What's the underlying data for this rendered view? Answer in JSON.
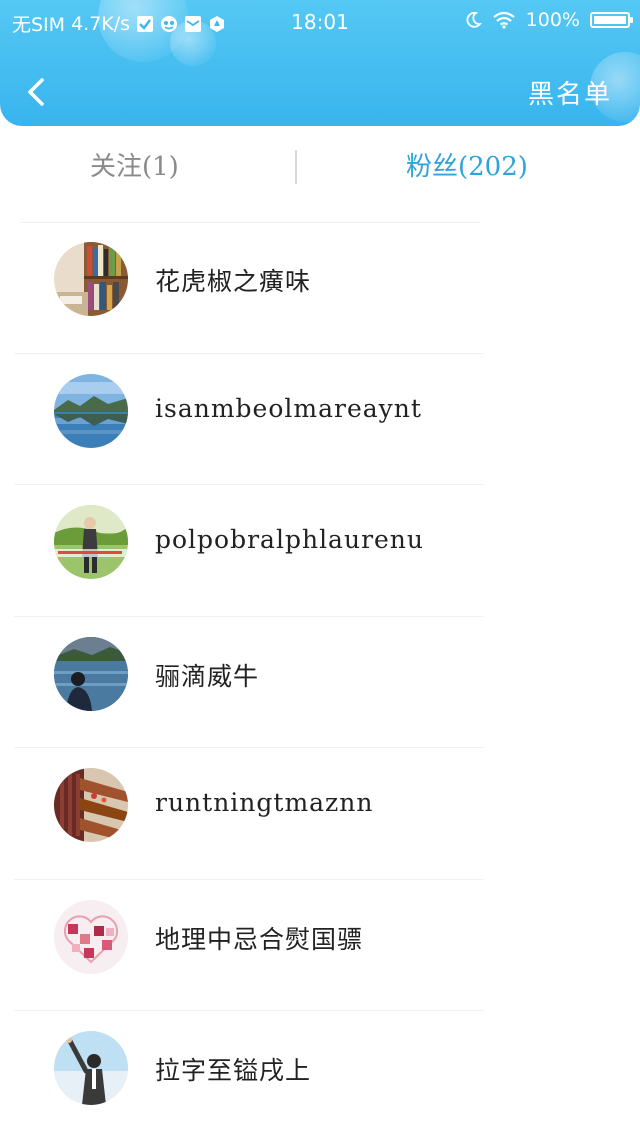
{
  "status_bar": {
    "carrier": "无SIM",
    "network_speed": "4.7K/s",
    "time": "18:01",
    "battery_level": "100%",
    "battery_fraction": 1.0,
    "icons": [
      "check-icon",
      "app-icon",
      "mail-icon",
      "app-shield-icon",
      "moon-icon",
      "wifi-icon",
      "battery-icon"
    ]
  },
  "header": {
    "back_icon": "chevron-left-icon",
    "blacklist_label": "黑名单",
    "background_color": "#3db7ef"
  },
  "tabs": {
    "following_label": "关注(1)",
    "followers_label": "粉丝(202)",
    "active": "followers",
    "active_color": "#2ea3db",
    "inactive_color": "#8a8a8a"
  },
  "followers": [
    {
      "name": "花虎椒之癀味",
      "avatar": "bookshelf-photo"
    },
    {
      "name": "isanmbeolmareaynt",
      "avatar": "lake-landscape-photo"
    },
    {
      "name": "polpobralphlaurenu",
      "avatar": "person-outdoor-photo"
    },
    {
      "name": "骊滴威牛",
      "avatar": "person-by-water-photo"
    },
    {
      "name": "runtningtmaznn",
      "avatar": "wooden-bench-photo"
    },
    {
      "name": "地理中忌合熨国骠",
      "avatar": "puzzle-heart-photo"
    },
    {
      "name": "拉字至镒戌上",
      "avatar": "person-sky-photo"
    }
  ]
}
